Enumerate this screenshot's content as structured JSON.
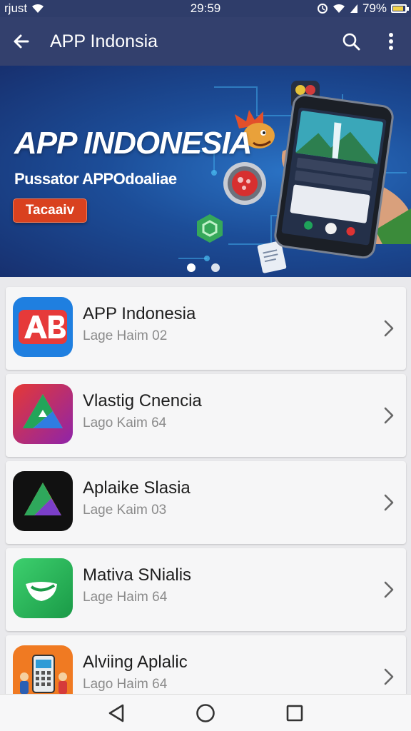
{
  "status_bar": {
    "carrier": "rjust",
    "time": "29:59",
    "battery": "79%",
    "battery_level": 0.79
  },
  "app_bar": {
    "title": "APP Indonsia",
    "back_icon": "arrow-left-icon",
    "search_icon": "search-icon",
    "menu_icon": "more-vert-icon"
  },
  "banner": {
    "title": "APP INDONESIA",
    "subtitle": "Pussator APPOdoaliae",
    "cta_label": "Tacaaiv",
    "active_slide": 1,
    "slide_count": 2
  },
  "apps": [
    {
      "name": "APP Indonesia",
      "meta": "Lage Haim 02",
      "icon": "ab-logo-icon"
    },
    {
      "name": "Vlastig Cnencia",
      "meta": "Lago Kaim 64",
      "icon": "triangle-drive-icon"
    },
    {
      "name": "Aplaike Slasia",
      "meta": "Lage Kaim 03",
      "icon": "dark-triangle-icon"
    },
    {
      "name": "Mativa SNialis",
      "meta": "Lage Haim 64",
      "icon": "green-leaf-icon"
    },
    {
      "name": "Alviing Aplalic",
      "meta": "Lago Haim 64",
      "icon": "calculator-people-icon"
    }
  ],
  "colors": {
    "header": "#33406d",
    "banner_cta": "#d9411f",
    "card_bg": "#f6f6f7"
  },
  "nav_bar": {
    "back_icon": "nav-back-triangle-icon",
    "home_icon": "nav-home-circle-icon",
    "recents_icon": "nav-recents-square-icon"
  }
}
